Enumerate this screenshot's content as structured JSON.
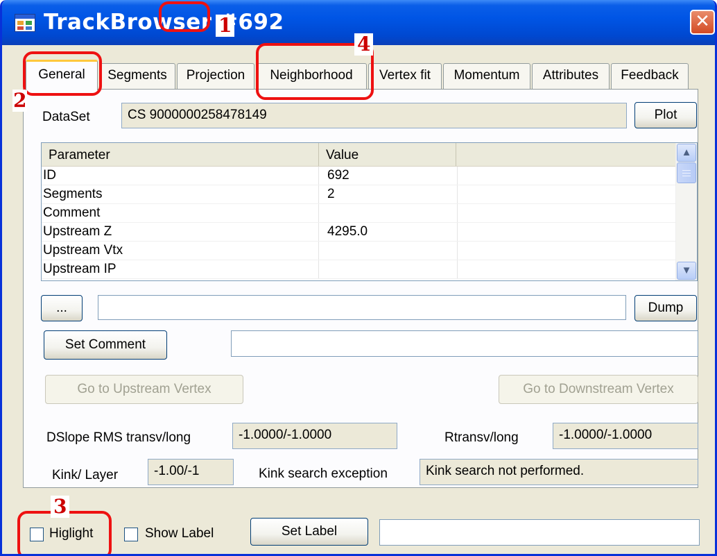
{
  "window": {
    "title": "TrackBrowser #692",
    "close_glyph": "✕",
    "icon": "window-app-icon"
  },
  "annotations": [
    "1",
    "2",
    "3",
    "4"
  ],
  "tabs": [
    "General",
    "Segments",
    "Projection",
    "Neighborhood",
    "Vertex fit",
    "Momentum",
    "Attributes",
    "Feedback"
  ],
  "active_tab": "General",
  "dataset": {
    "label": "DataSet",
    "value": "CS 9000000258478149",
    "plot_button": "Plot"
  },
  "grid": {
    "columns": [
      "Parameter",
      "Value",
      ""
    ],
    "rows": [
      {
        "param": "ID",
        "value": "692"
      },
      {
        "param": "Segments",
        "value": "2"
      },
      {
        "param": "Comment",
        "value": ""
      },
      {
        "param": "Upstream Z",
        "value": "4295.0"
      },
      {
        "param": "Upstream Vtx",
        "value": ""
      },
      {
        "param": "Upstream IP",
        "value": ""
      }
    ],
    "scroll_up_glyph": "▲",
    "scroll_down_glyph": "▼"
  },
  "path_row": {
    "browse_button": "...",
    "path_value": "",
    "dump_button": "Dump"
  },
  "comment_row": {
    "set_comment_button": "Set Comment",
    "comment_value": ""
  },
  "vertex_buttons": {
    "upstream": "Go to Upstream Vertex",
    "downstream": "Go to Downstream Vertex"
  },
  "stats": {
    "dslope_label": "DSlope RMS transv/long",
    "dslope_value": "-1.0000/-1.0000",
    "rtransv_label": "Rtransv/long",
    "rtransv_value": "-1.0000/-1.0000",
    "kink_label": "Kink/ Layer",
    "kink_value": "-1.00/-1",
    "kink_exc_label": "Kink search exception",
    "kink_exc_value": "Kink search not performed."
  },
  "bottom": {
    "highlight_label": "Higlight",
    "highlight_checked": false,
    "show_label_label": "Show Label",
    "show_label_checked": false,
    "set_label_button": "Set Label",
    "label_value": ""
  },
  "colors": {
    "titlebar": "#0055e5",
    "annotation": "#ee1111",
    "dialog_bg": "#ece9d8"
  }
}
